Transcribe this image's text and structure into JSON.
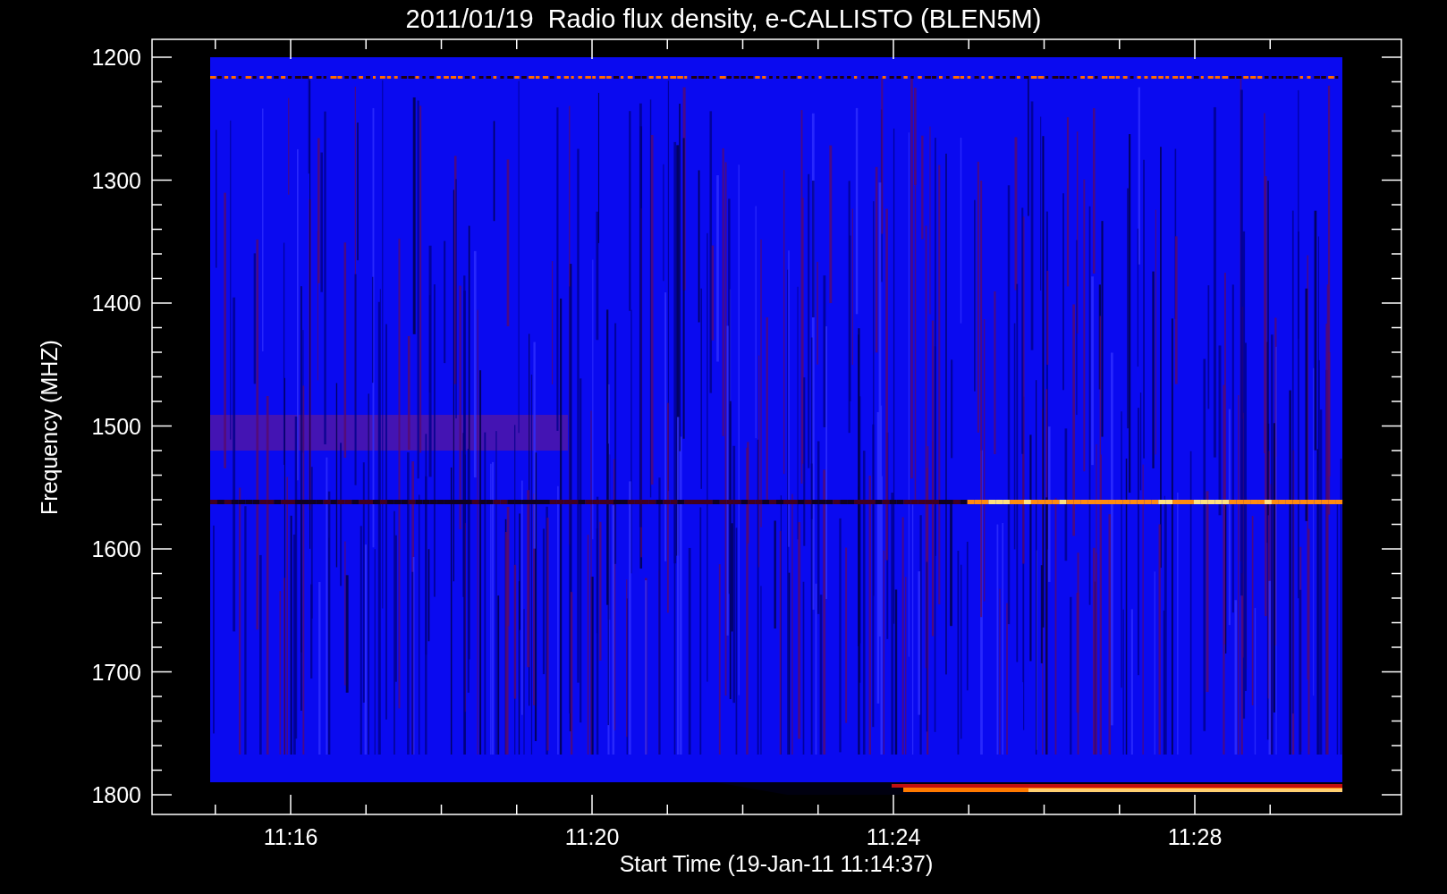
{
  "title": "2011/01/19  Radio flux density, e-CALLISTO (BLEN5M)",
  "y_axis": {
    "label": "Frequency (MHZ)",
    "ticks": [
      "1200",
      "1300",
      "1400",
      "1500",
      "1600",
      "1700",
      "1800"
    ]
  },
  "x_axis": {
    "label": "Start Time (19-Jan-11 11:14:37)",
    "ticks": [
      "11:16",
      "11:20",
      "11:24",
      "11:28"
    ]
  }
}
